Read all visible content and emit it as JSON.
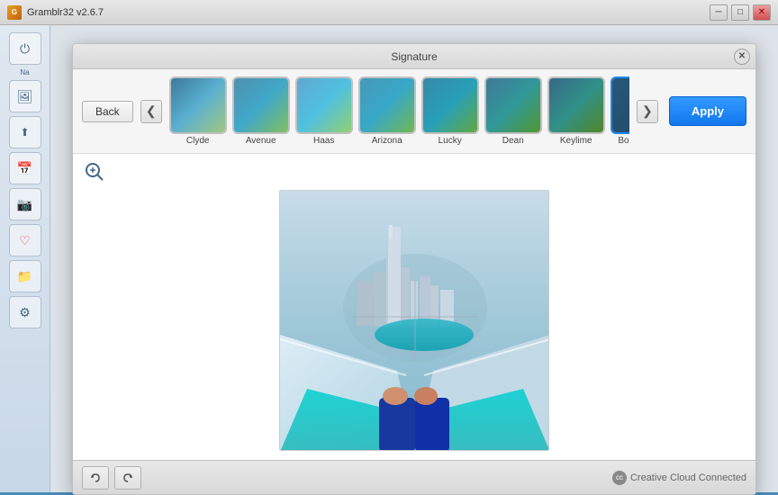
{
  "titlebar": {
    "app_name": "Gramblr32 v2.6.7",
    "min_label": "─",
    "max_label": "□",
    "close_label": "✕"
  },
  "dialog": {
    "title": "Signature",
    "close_label": "✕"
  },
  "toolbar": {
    "back_label": "Back",
    "prev_label": "❮",
    "next_label": "❯",
    "apply_label": "Apply"
  },
  "filters": [
    {
      "id": "clyde",
      "name": "Clyde",
      "class": "filter-clyde",
      "selected": false
    },
    {
      "id": "avenue",
      "name": "Avenue",
      "class": "filter-avenue",
      "selected": false
    },
    {
      "id": "haas",
      "name": "Haas",
      "class": "filter-haas",
      "selected": false
    },
    {
      "id": "arizona",
      "name": "Arizona",
      "class": "filter-arizona",
      "selected": false
    },
    {
      "id": "lucky",
      "name": "Lucky",
      "class": "filter-lucky",
      "selected": false
    },
    {
      "id": "dean",
      "name": "Dean",
      "class": "filter-dean",
      "selected": false
    },
    {
      "id": "keylime",
      "name": "Keylime",
      "class": "filter-keylime",
      "selected": false
    },
    {
      "id": "boardwalk",
      "name": "Boardwalk",
      "class": "filter-boardwalk",
      "selected": true
    }
  ],
  "bottom": {
    "undo_label": "◀",
    "redo_label": "▶",
    "cc_status": "Creative Cloud Connected"
  },
  "sidebar": {
    "items": [
      {
        "id": "power",
        "icon": "⏻"
      },
      {
        "id": "user",
        "icon": "Na"
      },
      {
        "id": "images",
        "icon": "🖼"
      },
      {
        "id": "upload",
        "icon": "⬆"
      },
      {
        "id": "calendar",
        "icon": "📅"
      },
      {
        "id": "photo",
        "icon": "📷"
      },
      {
        "id": "heart",
        "icon": "♡"
      },
      {
        "id": "folder",
        "icon": "📁"
      },
      {
        "id": "settings",
        "icon": "⚙"
      }
    ]
  }
}
